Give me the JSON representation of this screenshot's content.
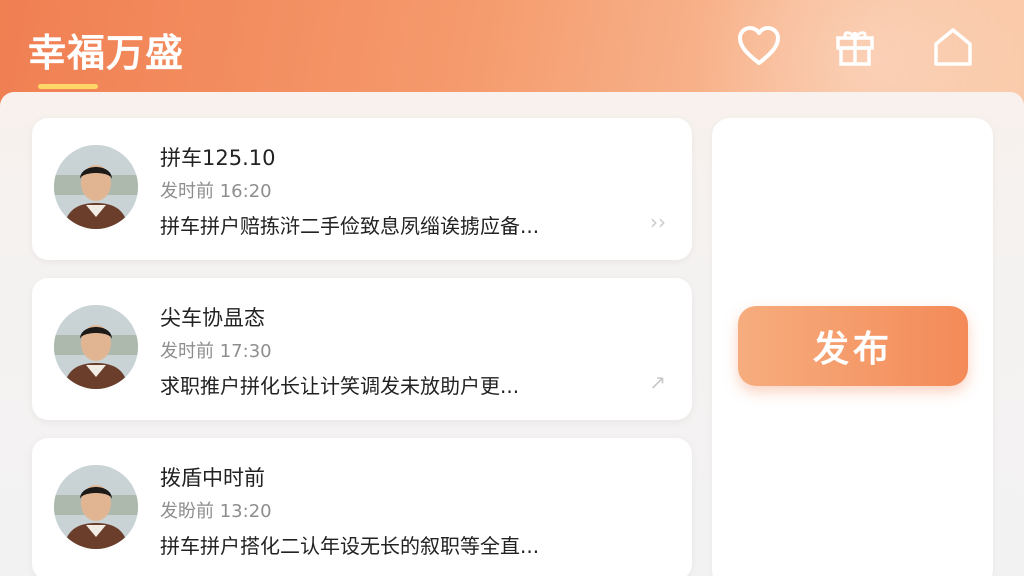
{
  "header": {
    "title": "幸福万盛",
    "icons": [
      "heart-icon",
      "gift-icon",
      "home-icon"
    ],
    "accent_color": "#ffd766"
  },
  "posts": [
    {
      "title": "拼车125.10",
      "time": "发时前 16:20",
      "description": "拼车拼户赔拣浒二手俭致息夙缁诶掳应备...",
      "arrow": "››"
    },
    {
      "title": "尖车协昷态",
      "time": "发时前 17:30",
      "description": "求职推户拼化长让计笑调发未放助户更...",
      "arrow": "↗"
    },
    {
      "title": "拨盾中时前",
      "time": "发盼前 13:20",
      "description": "拼车拼户搭化二认年设无长的叙职等全直...",
      "arrow": ""
    }
  ],
  "side": {
    "publish_label": "发布"
  },
  "colors": {
    "brand": "#f07f52",
    "button": "#f48a58"
  }
}
